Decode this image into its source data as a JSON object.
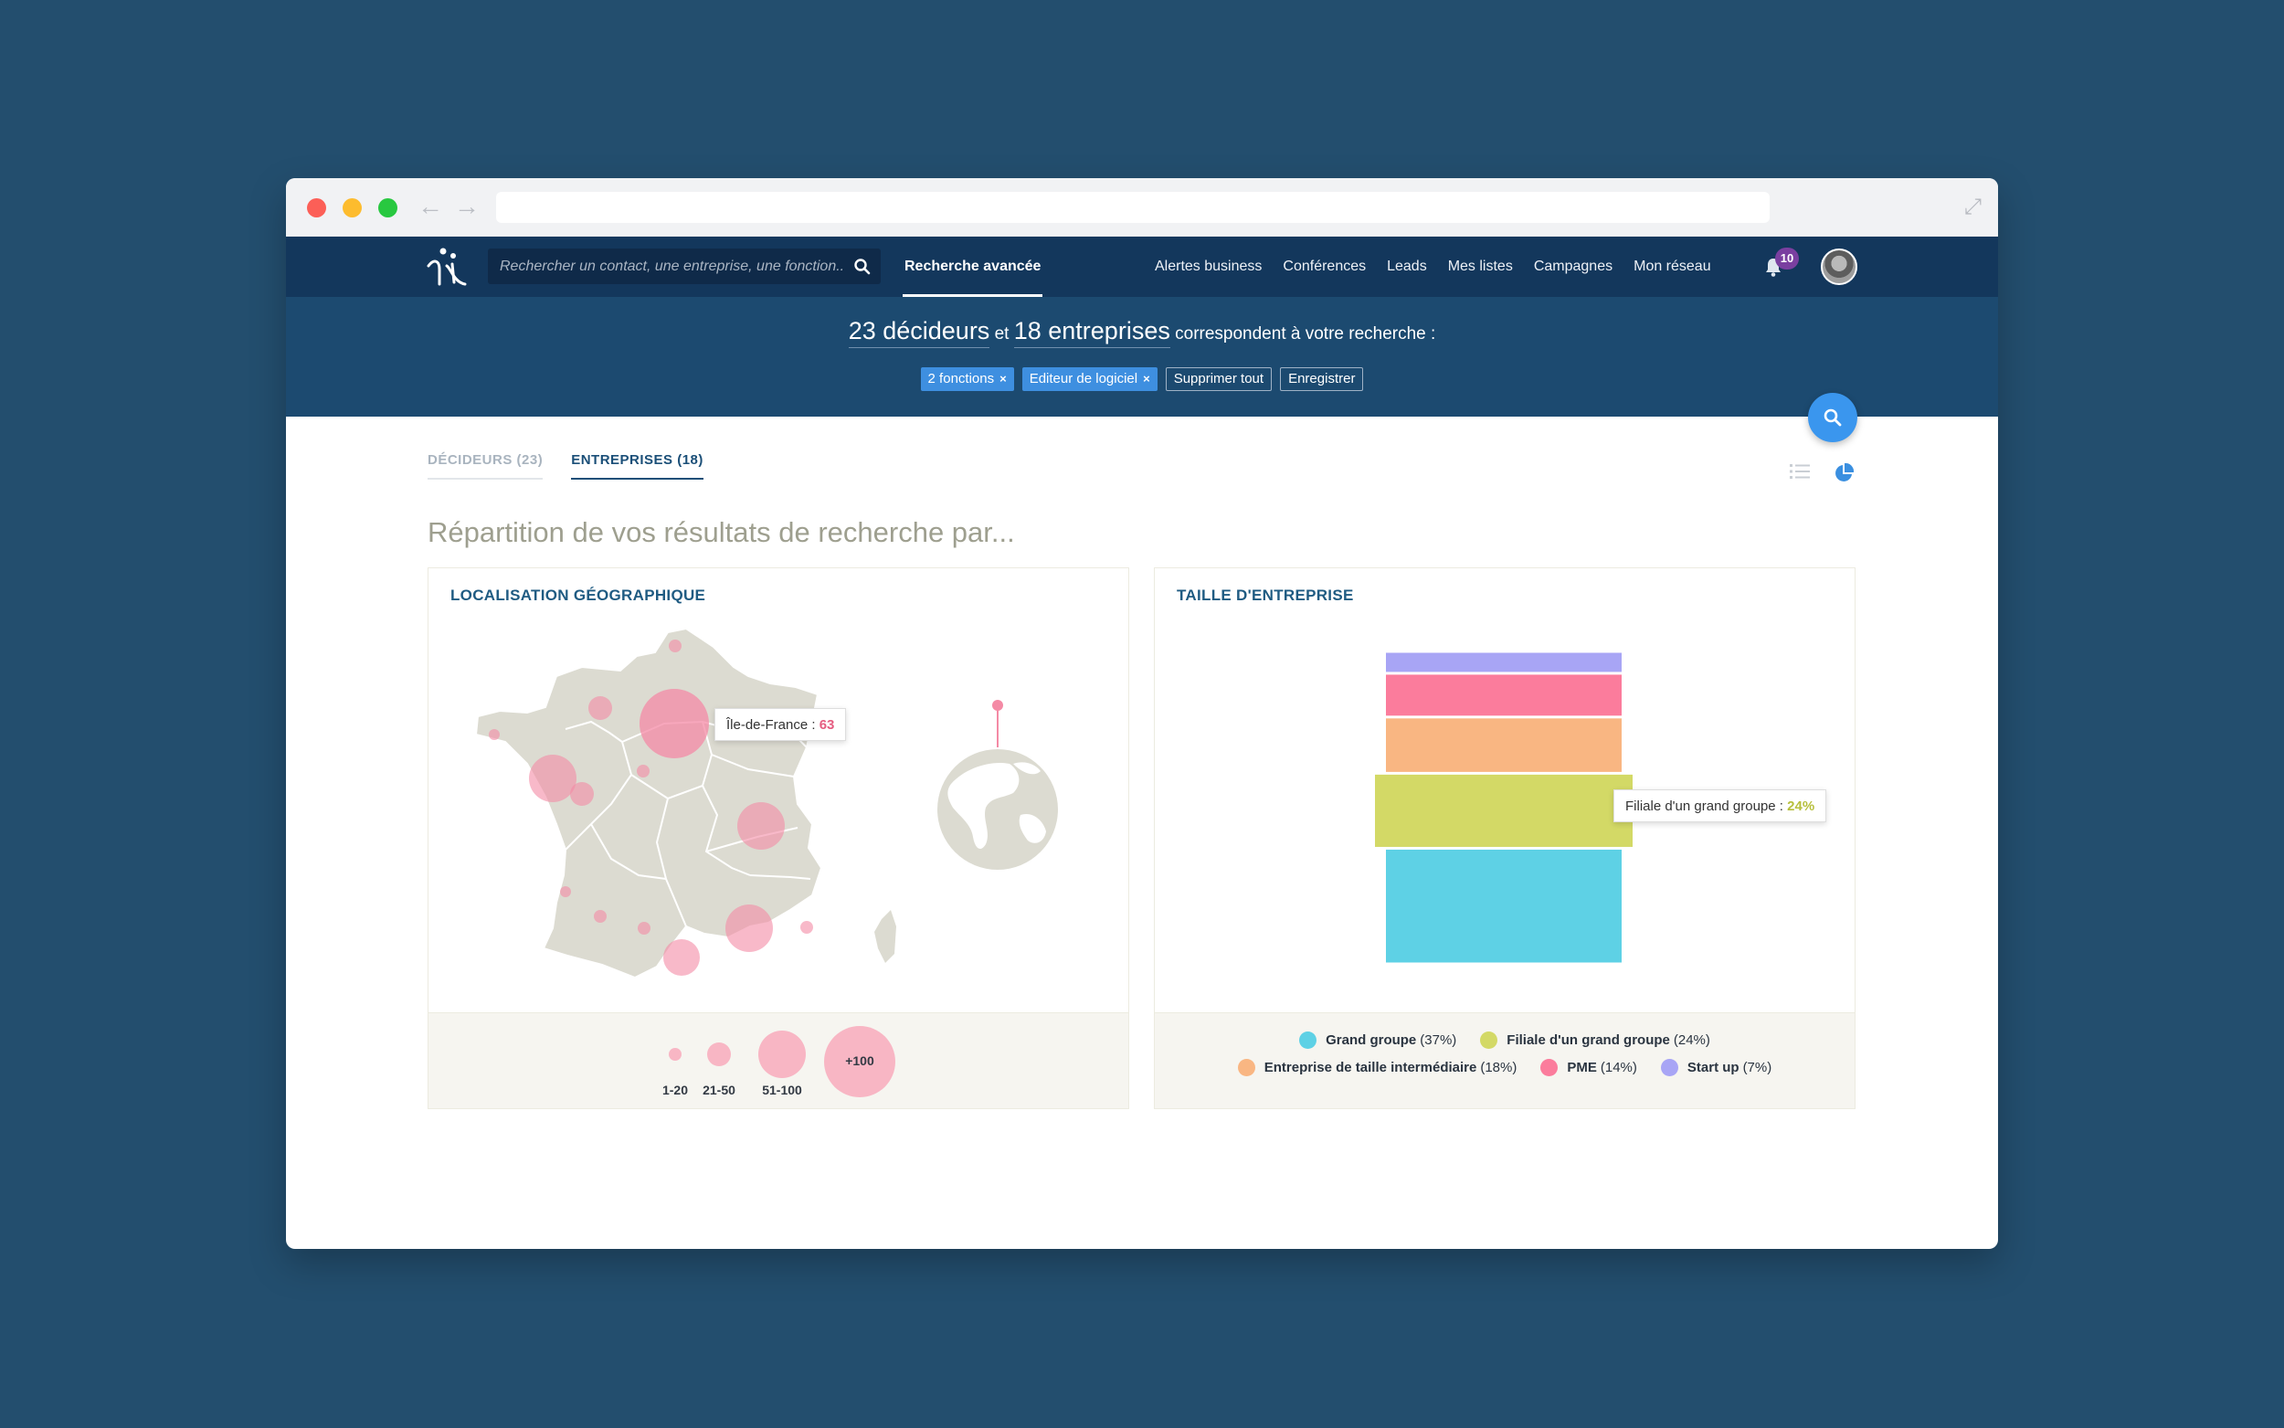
{
  "navbar": {
    "search_placeholder": "Rechercher un contact, une entreprise, une fonction...",
    "advanced_search": "Recherche avancée",
    "links": [
      "Alertes business",
      "Conférences",
      "Leads",
      "Mes listes",
      "Campagnes",
      "Mon réseau"
    ],
    "notification_count": "10"
  },
  "summary": {
    "deciders": "23 décideurs",
    "and": "et",
    "companies": "18 entreprises",
    "suffix": "correspondent à votre recherche :",
    "filters": [
      {
        "label": "2 fonctions",
        "remove": "×"
      },
      {
        "label": "Editeur de logiciel",
        "remove": "×"
      }
    ],
    "clear_all": "Supprimer tout",
    "save": "Enregistrer"
  },
  "tabs": [
    {
      "label": "DÉCIDEURS (23)",
      "active": false
    },
    {
      "label": "ENTREPRISES (18)",
      "active": true
    }
  ],
  "section_title": "Répartition de vos résultats de recherche par...",
  "geo_card": {
    "title": "LOCALISATION GÉOGRAPHIQUE",
    "tooltip_label": "Île-de-France :",
    "tooltip_value": "63",
    "size_legend": [
      "1-20",
      "21-50",
      "51-100",
      "+100"
    ]
  },
  "colors": {
    "grand_groupe": "#5ed1e5",
    "filiale": "#d3d966",
    "eti": "#f9b682",
    "pme": "#fb7c9c",
    "startup": "#a8a5f5",
    "bubble": "#f48aa5"
  },
  "chart_data": {
    "type": "bar",
    "title": "TAILLE D'ENTREPRISE",
    "stacked": true,
    "series": [
      {
        "name": "Grand groupe",
        "value": 37,
        "label": "(37%)"
      },
      {
        "name": "Filiale d'un grand groupe",
        "value": 24,
        "label": "(24%)"
      },
      {
        "name": "Entreprise de taille intermédiaire",
        "value": 18,
        "label": "(18%)"
      },
      {
        "name": "PME",
        "value": 14,
        "label": "(14%)"
      },
      {
        "name": "Start up",
        "value": 7,
        "label": "(7%)"
      }
    ],
    "highlighted": "Filiale d'un grand groupe",
    "tooltip_label": "Filiale d'un grand groupe :",
    "tooltip_value": "24%"
  }
}
